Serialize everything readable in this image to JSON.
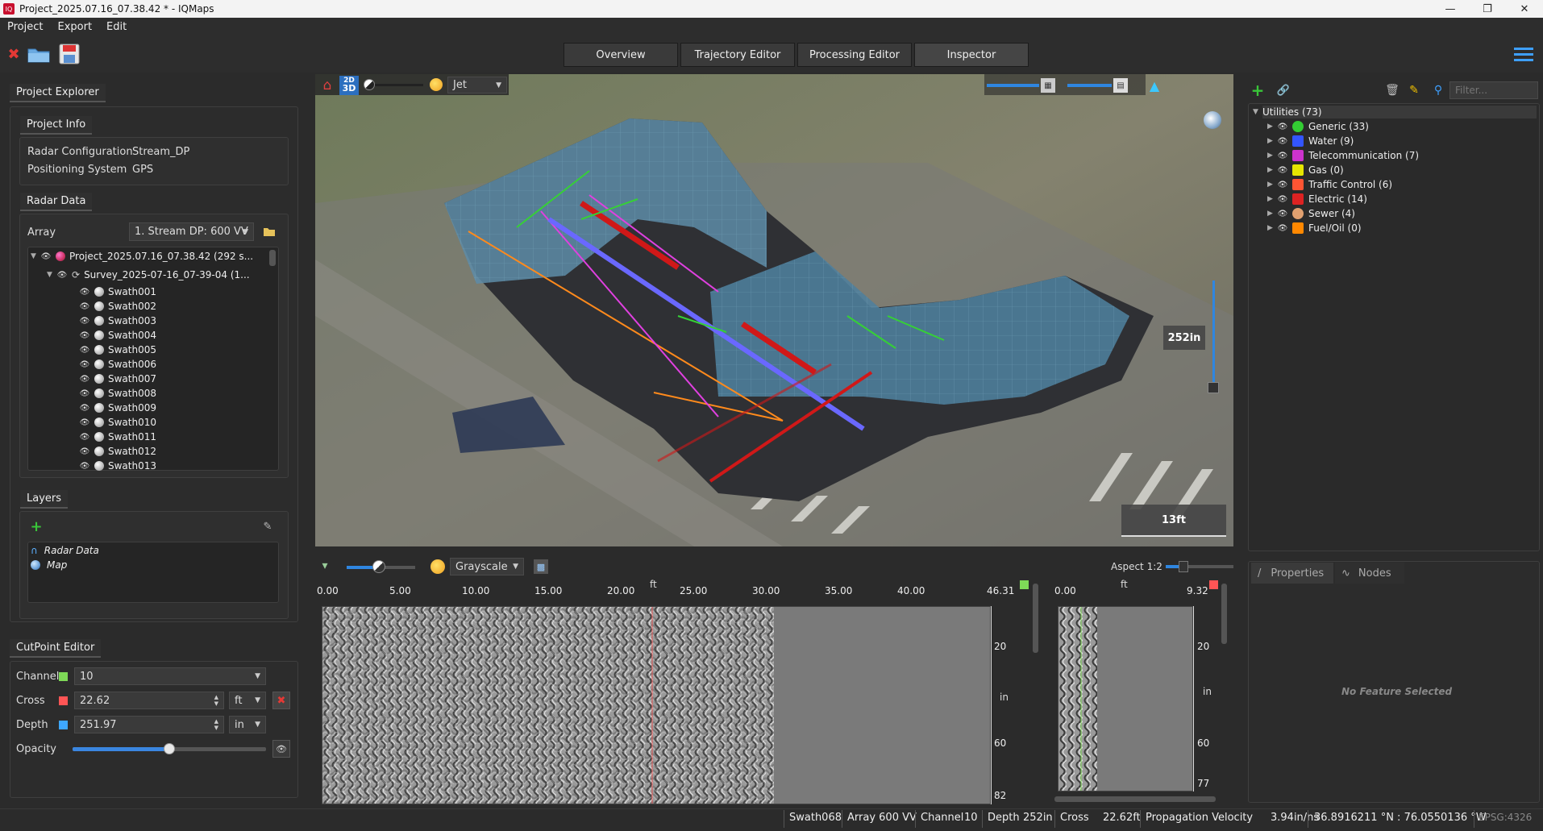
{
  "window": {
    "title": "Project_2025.07.16_07.38.42 * - IQMaps"
  },
  "menu": [
    "Project",
    "Export",
    "Edit"
  ],
  "tabs": [
    "Overview",
    "Trajectory Editor",
    "Processing Editor",
    "Inspector"
  ],
  "project_explorer": {
    "title": "Project Explorer",
    "project_info": {
      "title": "Project Info",
      "rows": [
        {
          "label": "Radar Configuration",
          "value": "Stream_DP"
        },
        {
          "label": "Positioning System",
          "value": "GPS"
        }
      ]
    },
    "radar_data": {
      "title": "Radar Data",
      "array_label": "Array",
      "array_value": "1. Stream DP: 600 VV",
      "project_node": "Project_2025.07.16_07.38.42 (292 s...",
      "survey_node": "Survey_2025-07-16_07-39-04 (1...",
      "swaths": [
        "Swath001",
        "Swath002",
        "Swath003",
        "Swath004",
        "Swath005",
        "Swath006",
        "Swath007",
        "Swath008",
        "Swath009",
        "Swath010",
        "Swath011",
        "Swath012",
        "Swath013"
      ]
    },
    "layers": {
      "title": "Layers",
      "items": [
        "Radar Data",
        "Map"
      ]
    }
  },
  "cutpoint_editor": {
    "title": "CutPoint Editor",
    "channel_label": "Channel",
    "channel_value": "10",
    "cross_label": "Cross",
    "cross_value": "22.62",
    "cross_unit": "ft",
    "depth_label": "Depth",
    "depth_value": "251.97",
    "depth_unit": "in",
    "opacity_label": "Opacity",
    "opacity_level": 0.5,
    "colors": {
      "channel": "#7ed957",
      "cross": "#ff5555",
      "depth": "#3ea7ff"
    }
  },
  "viewport": {
    "mode_label_top": "2D",
    "mode_label_bottom": "3D",
    "colormap": "Jet",
    "depth_label": "252in",
    "scale_label": "13ft"
  },
  "radargram": {
    "colormap": "Grayscale",
    "aspect": "Aspect 1:2",
    "x_unit": "ft",
    "x_ticks": [
      "0.00",
      "5.00",
      "10.00",
      "15.00",
      "20.00",
      "25.00",
      "30.00",
      "35.00",
      "40.00",
      "46.31"
    ],
    "y_unit": "in",
    "y_ticks": [
      "20",
      "60",
      "82"
    ],
    "side_x_ticks": [
      "0.00",
      "9.32"
    ],
    "side_x_unit": "ft",
    "side_y_ticks": [
      "20",
      "60",
      "77"
    ],
    "side_y_unit": "in"
  },
  "utilities": {
    "filter_placeholder": "Filter...",
    "root": "Utilities (73)",
    "items": [
      {
        "label": "Generic (33)",
        "color": "#33cc33"
      },
      {
        "label": "Water (9)",
        "color": "#3355ff"
      },
      {
        "label": "Telecommunication (7)",
        "color": "#cc33cc"
      },
      {
        "label": "Gas (0)",
        "color": "#e6e600"
      },
      {
        "label": "Traffic Control (6)",
        "color": "#ff5533"
      },
      {
        "label": "Electric (14)",
        "color": "#dd2222"
      },
      {
        "label": "Sewer (4)",
        "color": "#e0a070"
      },
      {
        "label": "Fuel/Oil (0)",
        "color": "#ff8800"
      }
    ]
  },
  "properties": {
    "tab_properties": "Properties",
    "tab_nodes": "Nodes",
    "empty": "No Feature Selected"
  },
  "status": {
    "swath": "Swath068",
    "array": "Array  600 VV",
    "channel_label": "Channel",
    "channel": "10",
    "depth_label": "Depth",
    "depth": "252in",
    "cross_label": "Cross",
    "cross": "22.62ft",
    "velocity_label": "Propagation Velocity",
    "velocity": "3.94in/ns",
    "coords": "36.8916211 °N : 76.0550136 °W",
    "epsg": "EPSG:4326"
  }
}
